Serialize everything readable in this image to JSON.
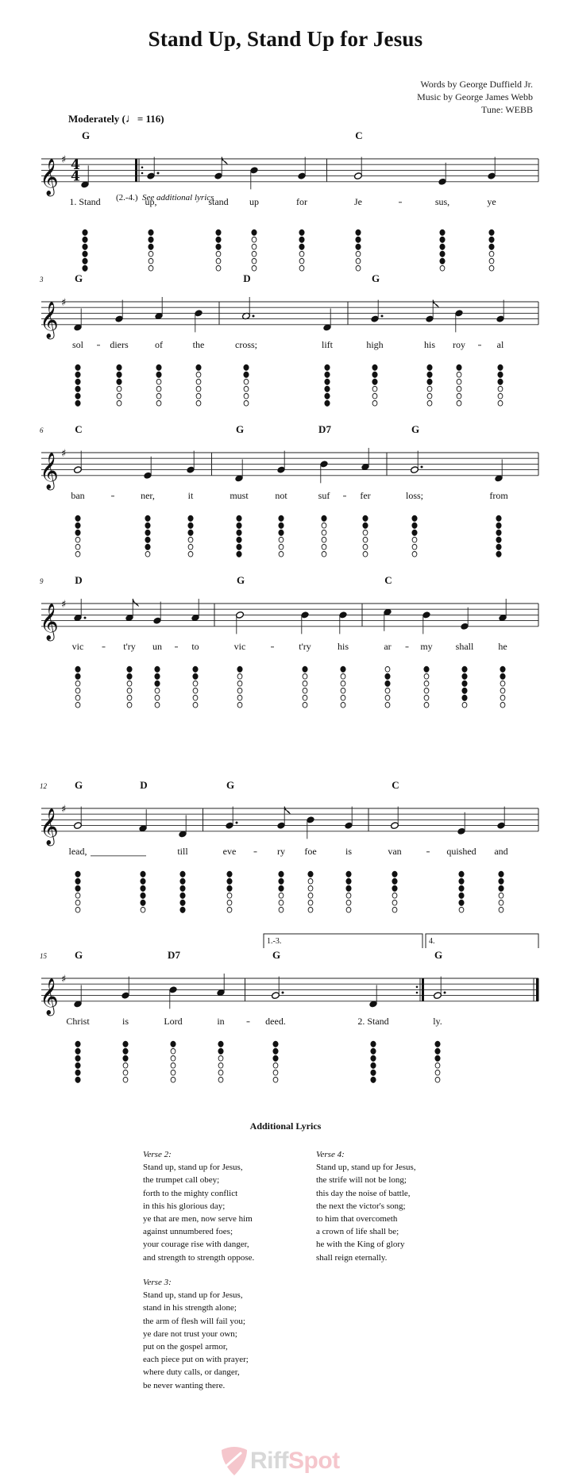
{
  "title": "Stand Up, Stand Up for Jesus",
  "credits": {
    "words": "Words by George Duffield Jr.",
    "music": "Music by George James Webb",
    "tune": "Tune: WEBB"
  },
  "tempo": {
    "label": "Moderately",
    "open": "(",
    "note": "♩",
    "value": "= 116)"
  },
  "key_signature": "G major (1 sharp)",
  "time_signature": "4/4",
  "colors": {
    "ink": "#111111",
    "watermark_gray": "#d8d8d8",
    "watermark_pink": "#f5c6cc"
  },
  "additional_hint": {
    "numbers": "(2.-4.)",
    "text": "See additional lyrics"
  },
  "systems": [
    {
      "measure_number": "",
      "chords": [
        {
          "label": "G",
          "note": 0
        },
        {
          "label": "C",
          "note": 5
        }
      ],
      "notes": [
        {
          "pitch": "D4",
          "dur": "q",
          "lyric": "1.  Stand",
          "fing": "111111",
          "barAfter": "repeat-start"
        },
        {
          "pitch": "G4",
          "dur": "q.",
          "lyric": "up,",
          "fing": "111000"
        },
        {
          "pitch": "G4",
          "dur": "8",
          "lyric": "stand",
          "fing": "111000"
        },
        {
          "pitch": "B4",
          "dur": "q",
          "lyric": "up",
          "fing": "100000"
        },
        {
          "pitch": "G4",
          "dur": "q",
          "lyric": "for",
          "fing": "111000",
          "barAfter": "single"
        },
        {
          "pitch": "G4",
          "dur": "h",
          "lyric": "Je",
          "hyphen": true,
          "fing": "111000"
        },
        {
          "pitch": "E4",
          "dur": "q",
          "lyric": "sus,",
          "fing": "111110"
        },
        {
          "pitch": "G4",
          "dur": "q",
          "lyric": "ye",
          "fing": "111000",
          "barAfter": "single"
        }
      ]
    },
    {
      "measure_number": "3",
      "chords": [
        {
          "label": "G",
          "note": 0
        },
        {
          "label": "D",
          "note": 4
        },
        {
          "label": "G",
          "note": 6
        }
      ],
      "notes": [
        {
          "pitch": "D4",
          "dur": "q",
          "lyric": "sol",
          "hyphen": true,
          "fing": "111111"
        },
        {
          "pitch": "G4",
          "dur": "q",
          "lyric": "diers",
          "fing": "111000"
        },
        {
          "pitch": "A4",
          "dur": "q",
          "lyric": "of",
          "fing": "110000"
        },
        {
          "pitch": "B4",
          "dur": "q",
          "lyric": "the",
          "fing": "100000",
          "barAfter": "single"
        },
        {
          "pitch": "A4",
          "dur": "h.",
          "lyric": "cross;",
          "fing": "110000"
        },
        {
          "pitch": "D4",
          "dur": "q",
          "lyric": "lift",
          "fing": "111111",
          "barAfter": "single"
        },
        {
          "pitch": "G4",
          "dur": "q.",
          "lyric": "high",
          "fing": "111000"
        },
        {
          "pitch": "G4",
          "dur": "8",
          "lyric": "his",
          "fing": "111000"
        },
        {
          "pitch": "B4",
          "dur": "q",
          "lyric": "roy",
          "hyphen": true,
          "fing": "100000"
        },
        {
          "pitch": "G4",
          "dur": "q",
          "lyric": "al",
          "fing": "111000",
          "barAfter": "single"
        }
      ]
    },
    {
      "measure_number": "6",
      "chords": [
        {
          "label": "C",
          "note": 0
        },
        {
          "label": "G",
          "note": 3
        },
        {
          "label": "D7",
          "note": 5
        },
        {
          "label": "G",
          "note": 7
        }
      ],
      "notes": [
        {
          "pitch": "G4",
          "dur": "h",
          "lyric": "ban",
          "hyphen": true,
          "fing": "111000"
        },
        {
          "pitch": "E4",
          "dur": "q",
          "lyric": "ner,",
          "fing": "111110"
        },
        {
          "pitch": "G4",
          "dur": "q",
          "lyric": "it",
          "fing": "111000",
          "barAfter": "single"
        },
        {
          "pitch": "D4",
          "dur": "q",
          "lyric": "must",
          "fing": "111111"
        },
        {
          "pitch": "G4",
          "dur": "q",
          "lyric": "not",
          "fing": "111000"
        },
        {
          "pitch": "B4",
          "dur": "q",
          "lyric": "suf",
          "hyphen": true,
          "fing": "100000"
        },
        {
          "pitch": "A4",
          "dur": "q",
          "lyric": "fer",
          "fing": "110000",
          "barAfter": "single"
        },
        {
          "pitch": "G4",
          "dur": "h.",
          "lyric": "loss;",
          "fing": "111000"
        },
        {
          "pitch": "D4",
          "dur": "q",
          "lyric": "from",
          "fing": "111111",
          "barAfter": "single"
        }
      ]
    },
    {
      "measure_number": "9",
      "chords": [
        {
          "label": "D",
          "note": 0
        },
        {
          "label": "G",
          "note": 4
        },
        {
          "label": "C",
          "note": 7
        }
      ],
      "notes": [
        {
          "pitch": "A4",
          "dur": "q.",
          "lyric": "vic",
          "hyphen": true,
          "fing": "110000"
        },
        {
          "pitch": "A4",
          "dur": "8",
          "lyric": "t'ry",
          "fing": "110000"
        },
        {
          "pitch": "G4",
          "dur": "q",
          "lyric": "un",
          "hyphen": true,
          "fing": "111000"
        },
        {
          "pitch": "A4",
          "dur": "q",
          "lyric": "to",
          "fing": "110000",
          "barAfter": "single"
        },
        {
          "pitch": "B4",
          "dur": "h",
          "lyric": "vic",
          "hyphen": true,
          "fing": "100000"
        },
        {
          "pitch": "B4",
          "dur": "q",
          "lyric": "t'ry",
          "fing": "100000"
        },
        {
          "pitch": "B4",
          "dur": "q",
          "lyric": "his",
          "fing": "100000",
          "barAfter": "single"
        },
        {
          "pitch": "C5",
          "dur": "q",
          "lyric": "ar",
          "hyphen": true,
          "fing": "011000"
        },
        {
          "pitch": "B4",
          "dur": "q",
          "lyric": "my",
          "fing": "100000"
        },
        {
          "pitch": "E4",
          "dur": "q",
          "lyric": "shall",
          "fing": "111110"
        },
        {
          "pitch": "A4",
          "dur": "q",
          "lyric": "he",
          "fing": "110000",
          "barAfter": "single"
        }
      ]
    },
    {
      "measure_number": "12",
      "chords": [
        {
          "label": "G",
          "note": 0
        },
        {
          "label": "D",
          "note": 1
        },
        {
          "label": "G",
          "note": 3
        },
        {
          "label": "C",
          "note": 7
        }
      ],
      "notes": [
        {
          "pitch": "G4",
          "dur": "h",
          "lyric": "lead,",
          "extender": true,
          "fing": "111000"
        },
        {
          "pitch": "F#4",
          "dur": "q",
          "lyric": "",
          "fing": "111110"
        },
        {
          "pitch": "D4",
          "dur": "q",
          "lyric": "till",
          "fing": "111111",
          "barAfter": "single"
        },
        {
          "pitch": "G4",
          "dur": "q.",
          "lyric": "eve",
          "hyphen": true,
          "fing": "111000"
        },
        {
          "pitch": "G4",
          "dur": "8",
          "lyric": "ry",
          "fing": "111000"
        },
        {
          "pitch": "B4",
          "dur": "q",
          "lyric": "foe",
          "fing": "100000"
        },
        {
          "pitch": "G4",
          "dur": "q",
          "lyric": "is",
          "fing": "111000",
          "barAfter": "single"
        },
        {
          "pitch": "G4",
          "dur": "h",
          "lyric": "van",
          "hyphen": true,
          "fing": "111000"
        },
        {
          "pitch": "E4",
          "dur": "q",
          "lyric": "quished",
          "fing": "111110"
        },
        {
          "pitch": "G4",
          "dur": "q",
          "lyric": "and",
          "fing": "111000",
          "barAfter": "single"
        }
      ]
    },
    {
      "measure_number": "15",
      "chords": [
        {
          "label": "G",
          "note": 0
        },
        {
          "label": "D7",
          "note": 2
        },
        {
          "label": "G",
          "note": 4
        },
        {
          "label": "G",
          "note": 6
        }
      ],
      "voltas": [
        {
          "label": "1.-3.",
          "from": 4,
          "to": 5
        },
        {
          "label": "4.",
          "from": 6,
          "to": 6
        }
      ],
      "notes": [
        {
          "pitch": "D4",
          "dur": "q",
          "lyric": "Christ",
          "fing": "111111"
        },
        {
          "pitch": "G4",
          "dur": "q",
          "lyric": "is",
          "fing": "111000"
        },
        {
          "pitch": "B4",
          "dur": "q",
          "lyric": "Lord",
          "fing": "100000"
        },
        {
          "pitch": "A4",
          "dur": "q",
          "lyric": "in",
          "hyphen": true,
          "fing": "110000",
          "barAfter": "single"
        },
        {
          "pitch": "G4",
          "dur": "h.",
          "lyric": "deed.",
          "fing": "111000"
        },
        {
          "pitch": "D4",
          "dur": "q",
          "lyric": "2.  Stand",
          "fing": "111111",
          "barAfter": "repeat-end"
        },
        {
          "pitch": "G4",
          "dur": "h.",
          "lyric": "ly.",
          "fing": "111000",
          "barAfter": "final"
        }
      ]
    }
  ],
  "additional_lyrics": {
    "title": "Additional Lyrics",
    "verses": [
      {
        "label": "Verse 2:",
        "lines": [
          "Stand up, stand up for Jesus,",
          "the trumpet call obey;",
          "forth to the mighty conflict",
          "in this his glorious day;",
          "ye that are men, now serve him",
          "against unnumbered foes;",
          "your courage rise with danger,",
          "and strength to strength oppose."
        ]
      },
      {
        "label": "Verse 3:",
        "lines": [
          "Stand up, stand up for Jesus,",
          "stand in his strength alone;",
          "the arm of flesh will fail you;",
          "ye dare not trust your own;",
          "put on the gospel armor,",
          "each piece put on with prayer;",
          "where duty calls, or danger,",
          "be never wanting there."
        ]
      },
      {
        "label": "Verse 4:",
        "lines": [
          "Stand up, stand up for Jesus,",
          "the strife will not be long;",
          "this day the noise of battle,",
          "the next the victor's song;",
          "to him that overcometh",
          "a crown of life shall be;",
          "he with the King of glory",
          "shall reign eternally."
        ]
      }
    ]
  },
  "watermark": {
    "riff": "Riff",
    "spot": "Spot"
  }
}
